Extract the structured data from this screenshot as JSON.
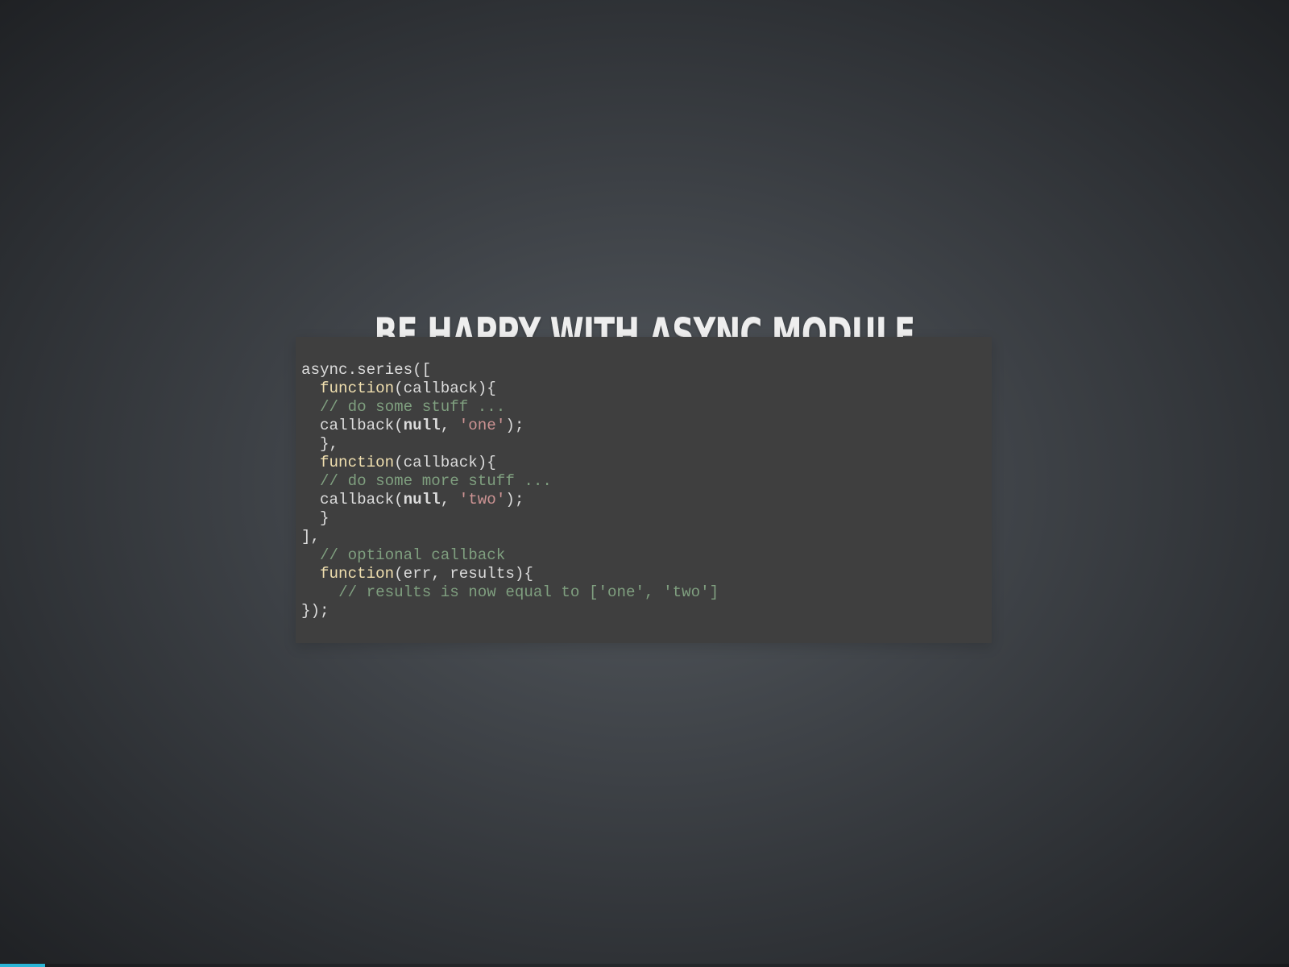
{
  "slide": {
    "title": "BE HAPPY WITH ASYNC MODULE"
  },
  "code": {
    "language": "javascript",
    "lines": [
      [
        {
          "t": "async.series([",
          "c": "pl"
        }
      ],
      [
        {
          "t": "  ",
          "c": "pl"
        },
        {
          "t": "function",
          "c": "kw"
        },
        {
          "t": "(callback){",
          "c": "pl"
        }
      ],
      [
        {
          "t": "  ",
          "c": "pl"
        },
        {
          "t": "// do some stuff ...",
          "c": "cm"
        }
      ],
      [
        {
          "t": "  callback(",
          "c": "pl"
        },
        {
          "t": "null",
          "c": "nl"
        },
        {
          "t": ", ",
          "c": "pl"
        },
        {
          "t": "'one'",
          "c": "str"
        },
        {
          "t": ");",
          "c": "pl"
        }
      ],
      [
        {
          "t": "  },",
          "c": "pl"
        }
      ],
      [
        {
          "t": "  ",
          "c": "pl"
        },
        {
          "t": "function",
          "c": "kw"
        },
        {
          "t": "(callback){",
          "c": "pl"
        }
      ],
      [
        {
          "t": "  ",
          "c": "pl"
        },
        {
          "t": "// do some more stuff ...",
          "c": "cm"
        }
      ],
      [
        {
          "t": "  callback(",
          "c": "pl"
        },
        {
          "t": "null",
          "c": "nl"
        },
        {
          "t": ", ",
          "c": "pl"
        },
        {
          "t": "'two'",
          "c": "str"
        },
        {
          "t": ");",
          "c": "pl"
        }
      ],
      [
        {
          "t": "  }",
          "c": "pl"
        }
      ],
      [
        {
          "t": "],",
          "c": "pl"
        }
      ],
      [
        {
          "t": "  ",
          "c": "pl"
        },
        {
          "t": "// optional callback",
          "c": "cm"
        }
      ],
      [
        {
          "t": "  ",
          "c": "pl"
        },
        {
          "t": "function",
          "c": "kw"
        },
        {
          "t": "(err, results){",
          "c": "pl"
        }
      ],
      [
        {
          "t": "    ",
          "c": "pl"
        },
        {
          "t": "// results is now equal to ['one', 'two']",
          "c": "cm"
        }
      ],
      [
        {
          "t": "});",
          "c": "pl"
        }
      ]
    ]
  },
  "progress": {
    "fraction": 0.035,
    "color": "#2ab5d6"
  },
  "colors": {
    "code_background": "#3f3f3f",
    "keyword": "#f0dfaf",
    "comment": "#7f9f7f",
    "string": "#cc9393",
    "text": "#dcdcdc"
  }
}
